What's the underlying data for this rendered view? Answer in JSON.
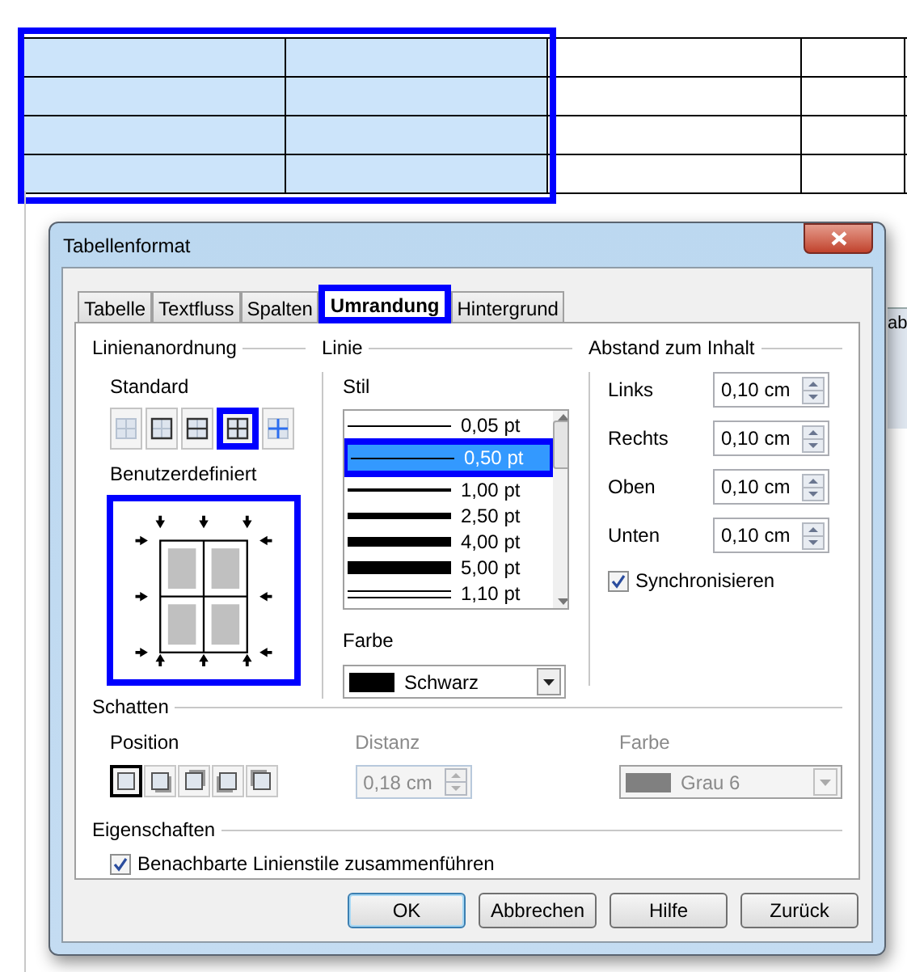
{
  "document_table": {
    "selection_annotated": true,
    "rows": [
      {
        "cells": [
          {
            "selected": true
          },
          {
            "selected": true
          },
          {
            "selected": false
          },
          {
            "selected": false
          }
        ]
      },
      {
        "cells": [
          {
            "selected": true
          },
          {
            "selected": true
          },
          {
            "selected": false
          },
          {
            "selected": false
          }
        ]
      },
      {
        "cells": [
          {
            "selected": true
          },
          {
            "selected": true
          },
          {
            "selected": false
          },
          {
            "selected": false
          }
        ]
      },
      {
        "cells": [
          {
            "selected": true
          },
          {
            "selected": true
          },
          {
            "selected": false
          },
          {
            "selected": false
          }
        ]
      }
    ]
  },
  "background_window": {
    "text": "ab"
  },
  "dialog": {
    "title": "Tabellenformat",
    "tabs": [
      {
        "label": "Tabelle",
        "selected": false,
        "annotated": false
      },
      {
        "label": "Textfluss",
        "selected": false,
        "annotated": false
      },
      {
        "label": "Spalten",
        "selected": false,
        "annotated": false
      },
      {
        "label": "Umrandung",
        "selected": true,
        "annotated": true
      },
      {
        "label": "Hintergrund",
        "selected": false,
        "annotated": false
      }
    ],
    "line_arrangement": {
      "title": "Linienanordnung",
      "standard_label": "Standard",
      "presets": [
        {
          "kind": "none",
          "annotated": false
        },
        {
          "kind": "outer",
          "annotated": false
        },
        {
          "kind": "outer-horizontal",
          "annotated": false
        },
        {
          "kind": "all",
          "annotated": true
        },
        {
          "kind": "inner",
          "annotated": false
        }
      ],
      "user_defined_label": "Benutzerdefiniert",
      "user_defined_annotated": true
    },
    "line": {
      "title": "Linie",
      "style_label": "Stil",
      "styles": [
        {
          "label": "0,05 pt",
          "kind": "hairline",
          "selected": false,
          "annotated": false
        },
        {
          "label": "0,50 pt",
          "kind": "thin",
          "selected": true,
          "annotated": true
        },
        {
          "label": "1,00 pt",
          "kind": "medium",
          "selected": false,
          "annotated": false
        },
        {
          "label": "2,50 pt",
          "kind": "thick",
          "selected": false,
          "annotated": false
        },
        {
          "label": "4,00 pt",
          "kind": "heavy",
          "selected": false,
          "annotated": false
        },
        {
          "label": "5,00 pt",
          "kind": "extra-heavy",
          "selected": false,
          "annotated": false
        },
        {
          "label": "1,10 pt",
          "kind": "double",
          "selected": false,
          "annotated": false
        }
      ],
      "color_label": "Farbe",
      "color": {
        "value": "Schwarz",
        "color": "#000000"
      }
    },
    "padding": {
      "title": "Abstand zum Inhalt",
      "fields": [
        {
          "label": "Links",
          "value": "0,10 cm"
        },
        {
          "label": "Rechts",
          "value": "0,10 cm"
        },
        {
          "label": "Oben",
          "value": "0,10 cm"
        },
        {
          "label": "Unten",
          "value": "0,10 cm"
        }
      ],
      "synchronize": {
        "label": "Synchronisieren",
        "checked": true
      }
    },
    "shadow": {
      "title": "Schatten",
      "position_label": "Position",
      "positions": [
        {
          "selected": true
        },
        {
          "selected": false
        },
        {
          "selected": false
        },
        {
          "selected": false
        },
        {
          "selected": false
        }
      ],
      "distance": {
        "label": "Distanz",
        "value": "0,18 cm",
        "disabled": true
      },
      "color": {
        "label": "Farbe",
        "value": "Grau 6",
        "color": "#808080",
        "disabled": true
      }
    },
    "properties": {
      "title": "Eigenschaften",
      "merge": {
        "label": "Benachbarte Linienstile zusammenführen",
        "checked": true
      }
    },
    "buttons": [
      {
        "label": "OK",
        "default": true
      },
      {
        "label": "Abbrechen",
        "default": false
      },
      {
        "label": "Hilfe",
        "default": false
      },
      {
        "label": "Zurück",
        "default": false
      }
    ]
  }
}
